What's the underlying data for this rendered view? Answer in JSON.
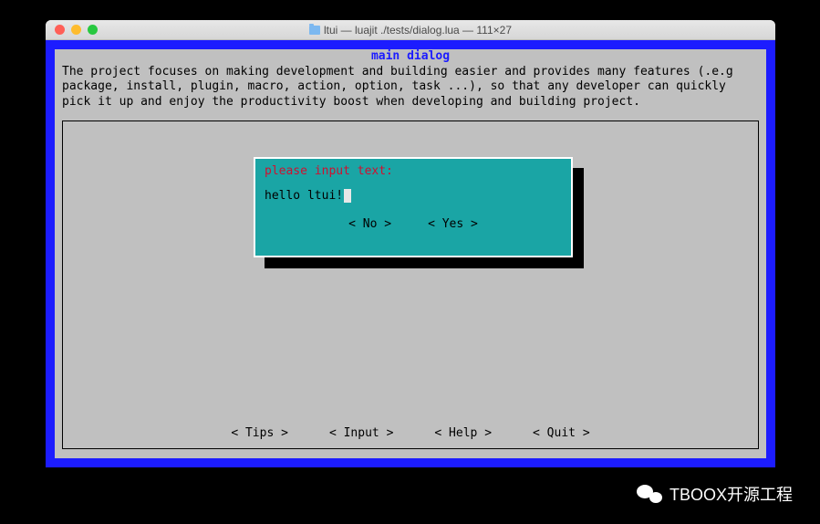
{
  "window": {
    "title": "ltui — luajit ./tests/dialog.lua — 111×27"
  },
  "main": {
    "title": "main dialog",
    "description": "The project focuses on making development and building easier and provides many features (.e.g package, install, plugin, macro, action, option, task ...), so that any developer can quickly pick it up and enjoy the productivity boost when developing and building project."
  },
  "input_dialog": {
    "prompt": "please input text:",
    "value": "hello ltui!",
    "buttons": {
      "no": "< No >",
      "yes": "< Yes >"
    }
  },
  "bottom_buttons": {
    "tips": "< Tips >",
    "input": "< Input >",
    "help": "< Help >",
    "quit": "< Quit >"
  },
  "watermark": "TBOOX开源工程"
}
